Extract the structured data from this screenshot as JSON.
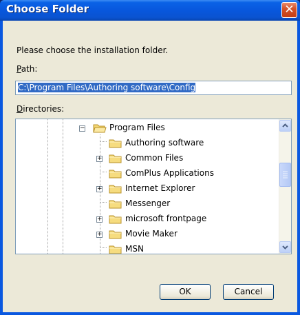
{
  "window": {
    "title": "Choose Folder",
    "close_glyph": "✕"
  },
  "prompt": "Please choose the installation folder.",
  "path": {
    "label_key": "P",
    "label_rest": "ath:",
    "value": "C:\\Program Files\\Authoring software\\Config"
  },
  "directories": {
    "label_key": "D",
    "label_rest": "irectories:",
    "items": [
      {
        "label": "Program Files",
        "expander": "−",
        "icon": "folder-open-icon"
      },
      {
        "label": "Authoring software",
        "expander": "",
        "icon": "folder-icon"
      },
      {
        "label": "Common Files",
        "expander": "+",
        "icon": "folder-icon"
      },
      {
        "label": "ComPlus Applications",
        "expander": "",
        "icon": "folder-icon"
      },
      {
        "label": "Internet Explorer",
        "expander": "+",
        "icon": "folder-icon"
      },
      {
        "label": "Messenger",
        "expander": "",
        "icon": "folder-icon"
      },
      {
        "label": "microsoft frontpage",
        "expander": "+",
        "icon": "folder-icon"
      },
      {
        "label": "Movie Maker",
        "expander": "+",
        "icon": "folder-icon"
      },
      {
        "label": "MSN",
        "expander": "",
        "icon": "folder-icon"
      }
    ]
  },
  "buttons": {
    "ok": "OK",
    "cancel": "Cancel"
  },
  "colors": {
    "titlebar": "#0a58e0",
    "face": "#ece9d8",
    "selection": "#316ac5",
    "close": "#d4532a"
  }
}
